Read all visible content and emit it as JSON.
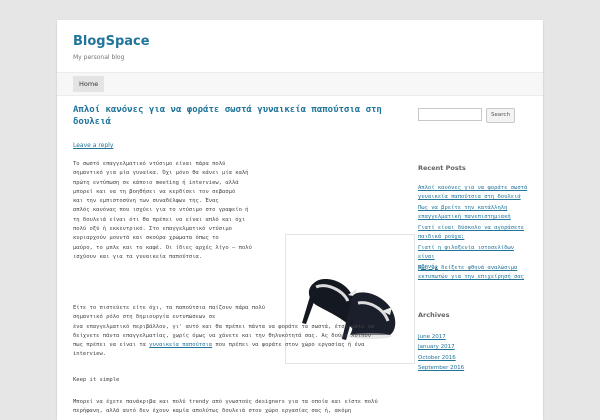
{
  "site": {
    "title": "BlogSpace",
    "description": "My personal blog"
  },
  "nav": {
    "items": [
      {
        "label": "Home"
      }
    ]
  },
  "post": {
    "title": "Απλοί κανόνες για να φοράτε σωστά γυναικεία παπούτσια στη δουλειά",
    "meta": "Leave a reply",
    "paragraphs": [
      {
        "lines": [
          "Το σωστό επαγγελματικό ντύσιμο είναι πάρα πολύ",
          "σημαντικό για μία γυναίκα. Όχι μόνο θα κάνει μία καλή",
          "πρώτη εντύπωση σε κάποιο meeting ή interview, αλλά",
          "μπορεί και να τη βοηθήσει να κερδίσει τον σεβασμό",
          "και την εμπιστοσύνη των συναδέλφων της. Ένας",
          "απλός κανόνας που ισχύει για το ντύσιμο στο γραφείο ή",
          "τη δουλειά είναι ότι θα πρέπει να είναι απλό και όχι",
          "πολύ οξύ ή εκκεντρικό. Στο επαγγελματικό ντύσιμο",
          "κυριαρχούν μουντά και σκούρα χρώματα όπως το",
          "μαύρο, το μπλε και το καφέ. Οι ίδιες αρχές λίγο – πολύ",
          "ισχύουν και για τα γυναικεία παπούτσια."
        ]
      },
      {
        "lines": [
          "Είτε το πιστεύετε είτε όχι, τα παπούτσια παίζουν πάρα πολύ",
          "σημαντικό ρόλο στη δημιουργία εντυπώσεων σε",
          "ένα επαγγελματικό περιβάλλον, γι' αυτό και θα πρέπει πάντα να φοράτε τα σωστά, έτσι ώστε να",
          "δείχνετε πάντα επαγγελματίας, χωρίς όμως να χάνετε και την θηλυκότητά σας. Ας δούμε λοιπόν",
          "πως πρέπει να είναι τα ",
          "interview."
        ],
        "link": "γυναικεία παπούτσια",
        "after_link": " που πρέπει να φοράτε στον χώρο εργασίας ή ένα"
      },
      {
        "lines": [
          "Keep it simple"
        ]
      },
      {
        "lines": [
          "Μπορεί να έχετε πανάκριβα και πολύ trendy από γνωστούς designers για τα οποία και είστε πολύ",
          "περήφανη, αλλά αυτό δεν έχουν καμία απολύτως δουλειά στον χώρο εργασίας σας ή, ακόμη"
        ]
      }
    ]
  },
  "sidebar": {
    "search": {
      "placeholder": "",
      "button_label": "Search"
    },
    "recent_posts": {
      "title": "Recent Posts",
      "items": [
        {
          "lines": [
            "Απλοί κανόνες για να φοράτε σωστά",
            "γυναικεία παπούτσια στη δουλειά"
          ]
        },
        {
          "lines": [
            "Πως να βρείτε την κατάλληλη",
            "επαγγελματική πανεπιστημιακή"
          ]
        },
        {
          "lines": [
            "Γιατί είναι δύσκολο να αγοράσετε",
            "παιδικά ρούχα;"
          ]
        },
        {
          "lines": [
            "Γιατί η φιλοξενία ιστοσελίδων είναι",
            "φθηνή;"
          ]
        },
        {
          "lines": [
            "Πως να δείξετε φθηνά αναλώσιμα",
            "εκτυπωτών για την επιχείρησή σας"
          ]
        }
      ]
    },
    "archives": {
      "title": "Archives",
      "items": [
        "June 2017",
        "January 2017",
        "October 2016",
        "September 2016"
      ]
    }
  },
  "colors": {
    "link": "#21759b",
    "background": "#e6e6e6",
    "text": "#444444"
  }
}
